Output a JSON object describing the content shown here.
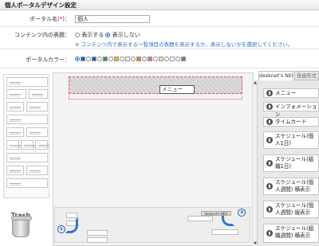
{
  "window": {
    "title": "個人ポータルデザイン設定"
  },
  "form": {
    "portal_name_label": "ポータル名",
    "required_mark": "(*)",
    "colon": "：",
    "portal_name_value": "個人",
    "content_title_label": "コンテンツ内の表題",
    "option_show": "表示する",
    "option_hide": "表示しない",
    "selected_title_option": "表示しない",
    "note": "※ コンテンツ内で表示する一覧項目の表題を表示するか、表示しないかを選択してください。",
    "portal_color_label": "ポータルカラー",
    "colors": [
      "#1e5fbf",
      "#1e5fbf",
      "#3b9a2f",
      "#ecbd1b",
      "#f0f0f0",
      "#e08a1e",
      "#e86ca0",
      "#f3d7a8",
      "#f6f6f6",
      "#7a7a7a"
    ],
    "selected_color_index": 0
  },
  "designer": {
    "menu_block": "メニュー",
    "trash_label": "Trash Box",
    "step1": "①",
    "step2": "②",
    "mini_tab": "desknet's NEO"
  },
  "palette_tabs": {
    "active": "desknet's NEO",
    "idle": "自由形式"
  },
  "palette_items": [
    "メニュー",
    "インフォメーション",
    "タイムカード",
    "スケジュール(個人1日)",
    "スケジュール(組織1日)",
    "スケジュール(個人週間) 横表示",
    "スケジュール(個人週間) 縦表示",
    "スケジュール(組織週間) 横表示"
  ]
}
